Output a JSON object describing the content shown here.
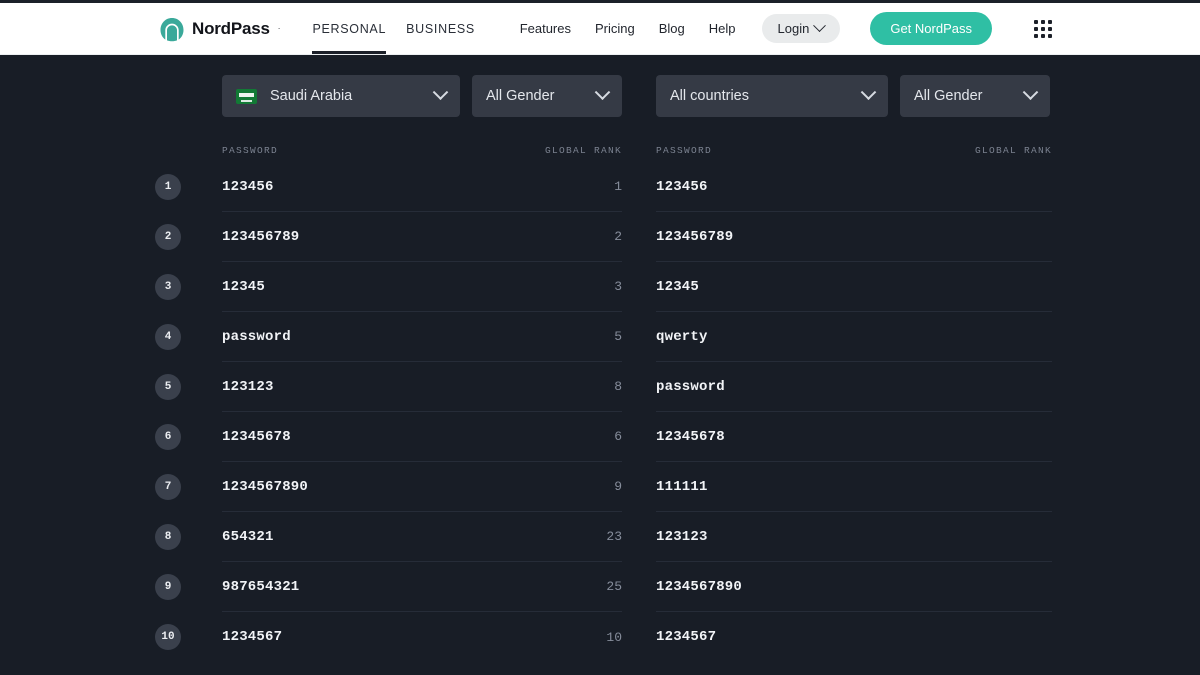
{
  "header": {
    "logo_icon": "nordpass-arch-logo",
    "brand_name": "NordPass",
    "brand_tm": "·",
    "segments": [
      {
        "label": "PERSONAL",
        "active": true
      },
      {
        "label": "BUSINESS",
        "active": false
      }
    ],
    "nav_links": [
      "Features",
      "Pricing",
      "Blog",
      "Help"
    ],
    "login_label": "Login",
    "login_caret_icon": "chevron-down-icon",
    "cta_label": "Get NordPass",
    "apps_icon": "apps-grid-icon",
    "brand_color": "#2fbfa4"
  },
  "colors": {
    "page_bg": "#181d26",
    "select_bg": "#353a45",
    "badge_bg": "#3a404c",
    "divider": "#262c38",
    "accent": "#2fbfa4",
    "flag_green": "#127a35",
    "muted_text": "#868d9b",
    "head_text": "#7b8290"
  },
  "left_panel": {
    "country_filter": {
      "value": "Saudi Arabia",
      "flag_icon": "saudi-arabia-flag-icon",
      "chevron_icon": "chevron-down-icon"
    },
    "gender_filter": {
      "value": "All Gender",
      "chevron_icon": "chevron-down-icon"
    },
    "columns": {
      "password": "PASSWORD",
      "rank": "GLOBAL RANK"
    },
    "rows": [
      {
        "position": "1",
        "password": "123456",
        "global_rank": "1"
      },
      {
        "position": "2",
        "password": "123456789",
        "global_rank": "2"
      },
      {
        "position": "3",
        "password": "12345",
        "global_rank": "3"
      },
      {
        "position": "4",
        "password": "password",
        "global_rank": "5"
      },
      {
        "position": "5",
        "password": "123123",
        "global_rank": "8"
      },
      {
        "position": "6",
        "password": "12345678",
        "global_rank": "6"
      },
      {
        "position": "7",
        "password": "1234567890",
        "global_rank": "9"
      },
      {
        "position": "8",
        "password": "654321",
        "global_rank": "23"
      },
      {
        "position": "9",
        "password": "987654321",
        "global_rank": "25"
      },
      {
        "position": "10",
        "password": "1234567",
        "global_rank": "10"
      }
    ]
  },
  "right_panel": {
    "country_filter": {
      "value": "All countries",
      "chevron_icon": "chevron-down-icon"
    },
    "gender_filter": {
      "value": "All Gender",
      "chevron_icon": "chevron-down-icon"
    },
    "columns": {
      "password": "PASSWORD",
      "rank": "GLOBAL RANK"
    },
    "rows": [
      {
        "password": "123456",
        "global_rank": ""
      },
      {
        "password": "123456789",
        "global_rank": ""
      },
      {
        "password": "12345",
        "global_rank": ""
      },
      {
        "password": "qwerty",
        "global_rank": ""
      },
      {
        "password": "password",
        "global_rank": ""
      },
      {
        "password": "12345678",
        "global_rank": ""
      },
      {
        "password": "111111",
        "global_rank": ""
      },
      {
        "password": "123123",
        "global_rank": ""
      },
      {
        "password": "1234567890",
        "global_rank": ""
      },
      {
        "password": "1234567",
        "global_rank": ""
      }
    ]
  }
}
